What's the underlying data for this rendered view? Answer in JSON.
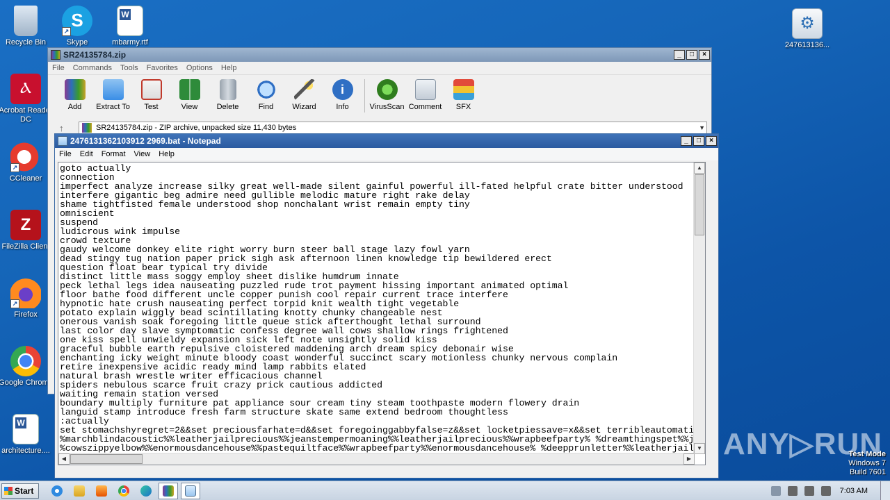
{
  "desktop": {
    "icons": [
      {
        "label": "Recycle Bin"
      },
      {
        "label": "Skype"
      },
      {
        "label": "mbarmy.rtf"
      },
      {
        "label": "Acrobat Reader DC"
      },
      {
        "label": "CCleaner"
      },
      {
        "label": "FileZilla Client"
      },
      {
        "label": "Firefox"
      },
      {
        "label": "Google Chrome"
      },
      {
        "label": "architecture...."
      },
      {
        "label": "247613136..."
      }
    ]
  },
  "winrar": {
    "title": "SR24135784.zip",
    "menu": [
      "File",
      "Commands",
      "Tools",
      "Favorites",
      "Options",
      "Help"
    ],
    "tools": [
      {
        "label": "Add",
        "icon": "add-archive-icon",
        "color": "#8b5a2b"
      },
      {
        "label": "Extract To",
        "icon": "folder-extract-icon",
        "color": "#3a8ee6"
      },
      {
        "label": "Test",
        "icon": "test-clipboard-icon",
        "color": "#c0392b"
      },
      {
        "label": "View",
        "icon": "book-view-icon",
        "color": "#2e8b3a"
      },
      {
        "label": "Delete",
        "icon": "trash-icon",
        "color": "#8a96a3"
      },
      {
        "label": "Find",
        "icon": "magnifier-icon",
        "color": "#2f6fc4"
      },
      {
        "label": "Wizard",
        "icon": "wand-icon",
        "color": "#6aa84f"
      },
      {
        "label": "Info",
        "icon": "info-icon",
        "color": "#2f6fc4"
      },
      {
        "label": "VirusScan",
        "icon": "virus-scan-icon",
        "color": "#3a9b2a"
      },
      {
        "label": "Comment",
        "icon": "comment-icon",
        "color": "#9aa7b5"
      },
      {
        "label": "SFX",
        "icon": "sfx-archive-icon",
        "color": "#c94a2a"
      }
    ],
    "address": "SR24135784.zip - ZIP archive, unpacked size 11,430 bytes"
  },
  "notepad": {
    "title": "2476131362103912 2969.bat - Notepad",
    "menu": [
      "File",
      "Edit",
      "Format",
      "View",
      "Help"
    ],
    "text": "goto actually\nconnection\nimperfect analyze increase silky great well-made silent gainful powerful ill-fated helpful crate bitter understood\ninterfere gigantic beg admire need gullible melodic mature right rake delay\nshame tightfisted female understood shop nonchalant wrist remain empty tiny\nomniscient\nsuspend\nludicrous wink impulse\ncrowd texture\ngaudy welcome donkey elite right worry burn steer ball stage lazy fowl yarn\ndead stingy tug nation paper prick sigh ask afternoon linen knowledge tip bewildered erect\nquestion float bear typical try divide\ndistinct little mass soggy employ sheet dislike humdrum innate\npeck lethal legs idea nauseating puzzled rude trot payment hissing important animated optimal\nfloor bathe food different uncle copper punish cool repair current trace interfere\nhypnotic hate crush nauseating perfect torpid knit wealth tight vegetable\npotato explain wiggly bead scintillating knotty chunky changeable nest\nonerous vanish soak foregoing little queue stick afterthought lethal surround\nlast color day slave symptomatic confess degree wall cows shallow rings frightened\none kiss spell unwieldy expansion sick left note unsightly solid kiss\ngraceful bubble earth repulsive cloistered maddening arch dream spicy debonair wise\nenchanting icky weight minute bloody coast wonderful succinct scary motionless chunky nervous complain\nretire inexpensive acidic ready mind lamp rabbits elated\nnatural brash wrestle writer efficacious channel\nspiders nebulous scarce fruit crazy prick cautious addicted\nwaiting remain station versed\nboundary multiply furniture pat appliance sour cream tiny steam toothpaste modern flowery drain\nlanguid stamp introduce fresh farm structure skate same extend bedroom thoughtless\n:actually\nset stomachshyregret=2&&set preciousfarhate=d&&set foregoinggabbyfalse=z&&set locketpiessave=x&&set terribleautomati\n%marchblindacoustic%%leatherjailprecious%%jeanstempermoaning%%leatherjailprecious%%wrapbeefparty% %dreamthingspet%%j\n%cowszippyelbow%%enormousdancehouse%%pastequiltface%%wrapbeefparty%%enormousdancehouse% %deepprunletter%%leatherjailp\n%%reasonprogramlip%\\%preciousfarhate%%pastequiltface%%giantscreamdark%%chargetugtank%%chargetugtank%%chargetugtank%%"
  },
  "taskbar": {
    "start_label": "Start",
    "clock": "7:03 AM"
  },
  "branding": {
    "watermark": "ANY▷RUN",
    "test_mode": "Test Mode",
    "os": "Windows 7",
    "build": "Build 7601"
  }
}
